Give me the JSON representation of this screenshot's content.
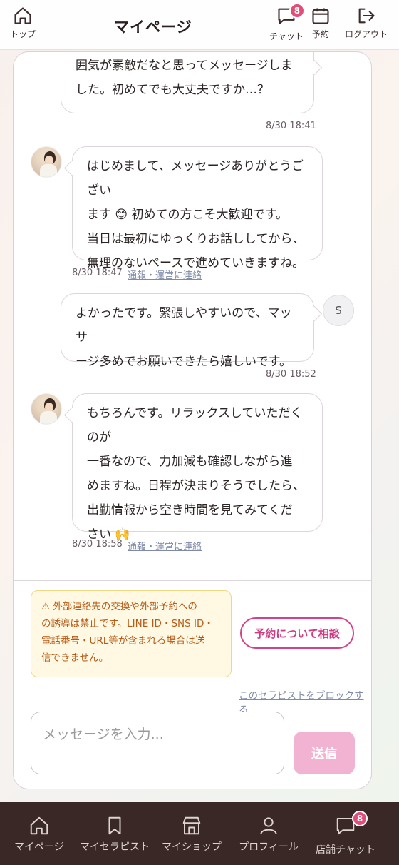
{
  "header": {
    "top_label": "トップ",
    "title": "マイページ",
    "chat_label": "チャット",
    "chat_badge": "8",
    "reservation_label": "予約",
    "logout_label": "ログアウト"
  },
  "messages": [
    {
      "side": "user",
      "lines": [
        "囲気が素敵だなと思ってメッセージしま",
        "した。初めてでも大丈夫ですか…？"
      ],
      "time": "8/30 18:41"
    },
    {
      "side": "therapist",
      "lines": [
        "はじめまして、メッセージありがとうござい",
        "ます 😊 初めての方こそ大歓迎です。",
        "当日は最初にゆっくりお話ししてから、",
        "無理のないペースで進めていきますね。"
      ],
      "time": "8/30 18:47",
      "report": "通報・運営に連絡"
    },
    {
      "side": "user",
      "avatar_letter": "S",
      "lines": [
        "よかったです。緊張しやすいので、マッサ",
        "ージ多めでお願いできたら嬉しいです。"
      ],
      "time": "8/30 18:52"
    },
    {
      "side": "therapist",
      "lines": [
        "もちろんです。リラックスしていただくのが",
        "一番なので、力加減も確認しながら進",
        "めますね。日程が決まりそうでしたら、",
        "出勤情報から空き時間を見てみてくだ",
        "さい 🙌"
      ],
      "time": "8/30 18:58",
      "report": "通報・運営に連絡"
    }
  ],
  "warning": {
    "lines": [
      "⚠ 外部連絡先の交換や外部予約への",
      "の誘導は禁止です。LINE ID・SNS ID・",
      "電話番号・URL等が含まれる場合は送",
      "信できません。"
    ]
  },
  "consult_button": "予約について相談",
  "block_link": "このセラピストをブロックする",
  "input": {
    "placeholder": "メッセージを入力..."
  },
  "send_button": "送信",
  "bottom_nav": {
    "items": [
      "マイページ",
      "マイセラピスト",
      "マイショップ",
      "プロフィール",
      "店舗チャット"
    ],
    "chat_badge": "8"
  },
  "colors": {
    "accent": "#d4418a",
    "send_disabled": "#f1b3d1",
    "badge": "#e04e7a",
    "nav_bg": "#3a2826",
    "warning_bg": "#fff9e3",
    "warning_text": "#b65a18"
  }
}
